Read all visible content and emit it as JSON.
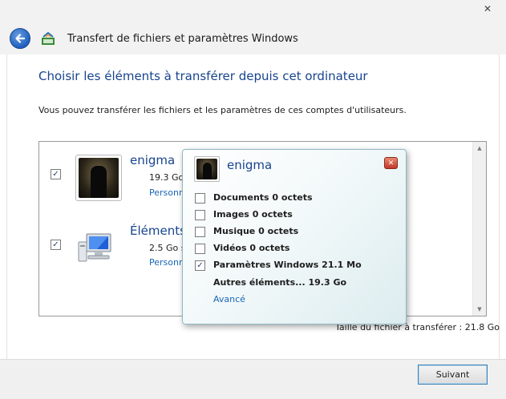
{
  "window": {
    "title": "Transfert de fichiers et paramètres Windows",
    "close_label": "✕"
  },
  "main": {
    "heading": "Choisir les éléments à transférer depuis cet ordinateur",
    "description": "Vous pouvez transférer les fichiers et les paramètres de ces comptes d'utilisateurs.",
    "accounts": [
      {
        "name": "enigma",
        "size": "19.3 Go",
        "link": "Personn",
        "checked": true
      },
      {
        "name": "Éléments",
        "size": "2.5 Go s",
        "link": "Personn",
        "checked": true
      }
    ],
    "total": "Taille du fichier à transférer : 21.8 Go"
  },
  "popup": {
    "title": "enigma",
    "close_label": "✕",
    "items": [
      {
        "label": "Documents 0 octets",
        "checked": false
      },
      {
        "label": "Images 0 octets",
        "checked": false
      },
      {
        "label": "Musique 0 octets",
        "checked": false
      },
      {
        "label": "Vidéos 0 octets",
        "checked": false
      },
      {
        "label": "Paramètres Windows 21.1 Mo",
        "checked": true
      }
    ],
    "other": "Autres éléments... 19.3 Go",
    "advanced_link": "Avancé"
  },
  "footer": {
    "next_label": "Suivant"
  },
  "icons": {
    "back": "back-arrow-icon",
    "check": "✓"
  }
}
